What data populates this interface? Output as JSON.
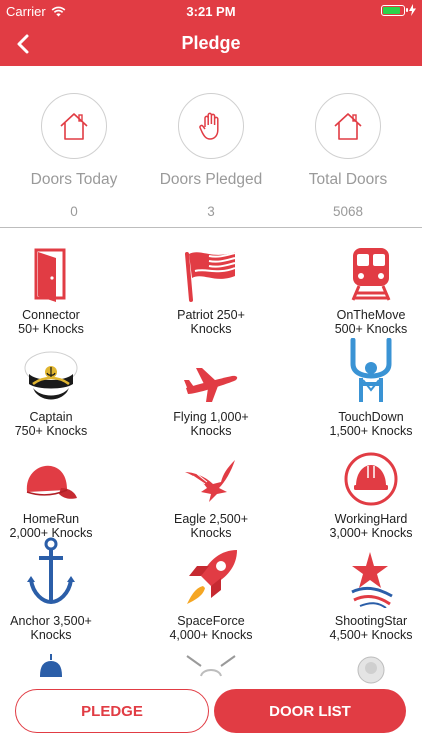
{
  "status_bar": {
    "carrier": "Carrier",
    "time": "3:21 PM"
  },
  "nav": {
    "title": "Pledge",
    "back_icon": "chevron-left-icon"
  },
  "stats": [
    {
      "label": "Doors Today",
      "value": "0",
      "icon": "house-icon"
    },
    {
      "label": "Doors Pledged",
      "value": "3",
      "icon": "raised-hand-icon"
    },
    {
      "label": "Total Doors",
      "value": "5068",
      "icon": "house-icon"
    }
  ],
  "badges": [
    {
      "line1": "Connector",
      "line2": "50+ Knocks",
      "icon": "door-icon"
    },
    {
      "line1": "Patriot 250+",
      "line2": "Knocks",
      "icon": "flag-icon"
    },
    {
      "line1": "OnTheMove",
      "line2": "500+ Knocks",
      "icon": "train-icon"
    },
    {
      "line1": "Captain",
      "line2": "750+ Knocks",
      "icon": "captain-hat-icon"
    },
    {
      "line1": "Flying 1,000+",
      "line2": "Knocks",
      "icon": "airplane-icon"
    },
    {
      "line1": "TouchDown",
      "line2": "1,500+ Knocks",
      "icon": "referee-touchdown-icon"
    },
    {
      "line1": "HomeRun",
      "line2": "2,000+ Knocks",
      "icon": "baseball-cap-icon"
    },
    {
      "line1": "Eagle 2,500+",
      "line2": "Knocks",
      "icon": "eagle-icon"
    },
    {
      "line1": "WorkingHard",
      "line2": "3,000+ Knocks",
      "icon": "hard-hat-icon"
    },
    {
      "line1": "Anchor 3,500+",
      "line2": "Knocks",
      "icon": "anchor-icon"
    },
    {
      "line1": "SpaceForce",
      "line2": "4,000+ Knocks",
      "icon": "rocket-icon"
    },
    {
      "line1": "ShootingStar",
      "line2": "4,500+ Knocks",
      "icon": "shooting-star-icon"
    }
  ],
  "buttons": {
    "pledge": "PLEDGE",
    "door_list": "DOOR LIST"
  },
  "colors": {
    "brand_red": "#e13c44",
    "battery_green": "#2bd34a",
    "muted_text": "#9a9a9a",
    "anchor_blue": "#2b5ea8"
  }
}
